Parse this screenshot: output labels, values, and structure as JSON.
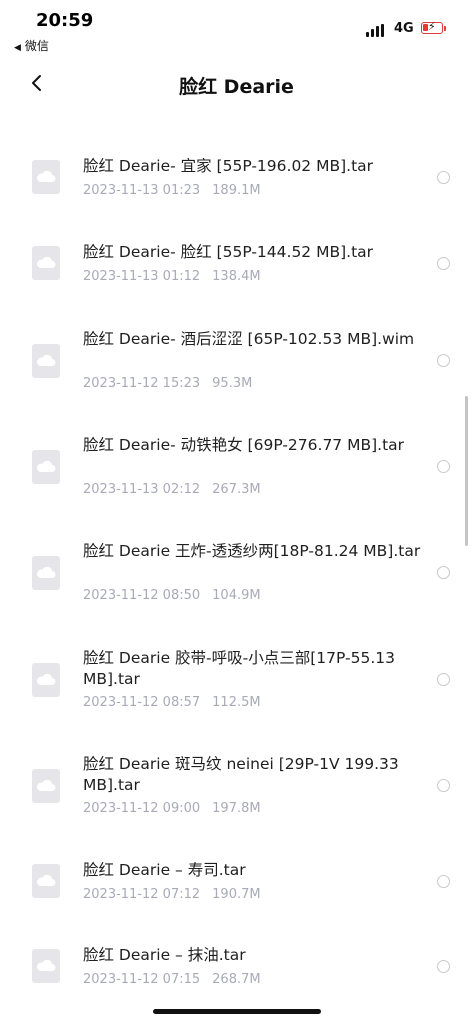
{
  "status_bar": {
    "time": "20:59",
    "back_app": "微信",
    "network": "4G"
  },
  "nav": {
    "title": "脸红 Dearie"
  },
  "files": [
    {
      "name": "脸红 Dearie- 宜家 [55P-196.02 MB].tar",
      "date": "2023-11-13 01:23",
      "size": "189.1M"
    },
    {
      "name": "脸红 Dearie- 脸红 [55P-144.52 MB].tar",
      "date": "2023-11-13 01:12",
      "size": "138.4M"
    },
    {
      "name": "脸红 Dearie- 酒后涩涩 [65P-102.53 MB].wim",
      "date": "2023-11-12 15:23",
      "size": "95.3M"
    },
    {
      "name": "脸红 Dearie-  动铁艳女 [69P-276.77 MB].tar",
      "date": "2023-11-13 02:12",
      "size": "267.3M"
    },
    {
      "name": "脸红 Dearie 王炸-透透纱两[18P-81.24 MB].tar",
      "date": "2023-11-12 08:50",
      "size": "104.9M"
    },
    {
      "name": "脸红 Dearie 胶带-呼吸-小点三部[17P-55.13 MB].tar",
      "date": "2023-11-12 08:57",
      "size": "112.5M"
    },
    {
      "name": "脸红 Dearie 斑马纹 neinei [29P-1V 199.33 MB].tar",
      "date": "2023-11-12 09:00",
      "size": "197.8M"
    },
    {
      "name": "脸红 Dearie – 寿司.tar",
      "date": "2023-11-12 07:12",
      "size": "190.7M"
    },
    {
      "name": "脸红 Dearie – 抹油.tar",
      "date": "2023-11-12 07:15",
      "size": "268.7M"
    }
  ],
  "colors": {
    "meta_text": "#a9aab8",
    "icon_bg": "#e6e6ea",
    "battery_low": "#e53935"
  },
  "icons": {
    "file": "cloud-file-icon",
    "back": "chevron-left-icon",
    "select": "radio-circle-icon"
  }
}
